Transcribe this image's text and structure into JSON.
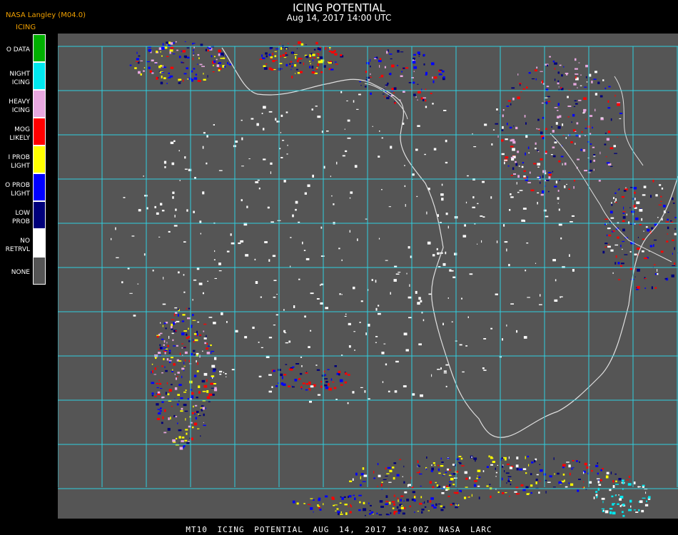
{
  "header": {
    "org": "NASA Langley (M04.0)",
    "title": "ICING POTENTIAL",
    "subtitle": "Aug 14, 2017 14:00 UTC"
  },
  "legend": {
    "title": "ICING",
    "items": [
      {
        "label": "O DATA",
        "color": "#00b000"
      },
      {
        "label": "NIGHT\nICING",
        "color": "#00e8f0"
      },
      {
        "label": "HEAVY\nICING",
        "color": "#e8a8e0"
      },
      {
        "label": "MOG\nLIKELY",
        "color": "#ff0000"
      },
      {
        "label": "I PROB\nLIGHT",
        "color": "#ffff00"
      },
      {
        "label": "O PROB\nLIGHT",
        "color": "#0000ff"
      },
      {
        "label": "LOW\nPROB",
        "color": "#00007a"
      },
      {
        "label": "NO\nRETRVL",
        "color": "#ffffff"
      },
      {
        "label": "NONE",
        "color": "#555555"
      }
    ]
  },
  "footer": "MT10  ICING POTENTIAL  AUG 14, 2017 14:00Z  NASA LARC",
  "colors": {
    "background": "#555555",
    "grid": "#30d0e0",
    "coast": "#e0e0e0",
    "label_red": "#ff3030"
  }
}
